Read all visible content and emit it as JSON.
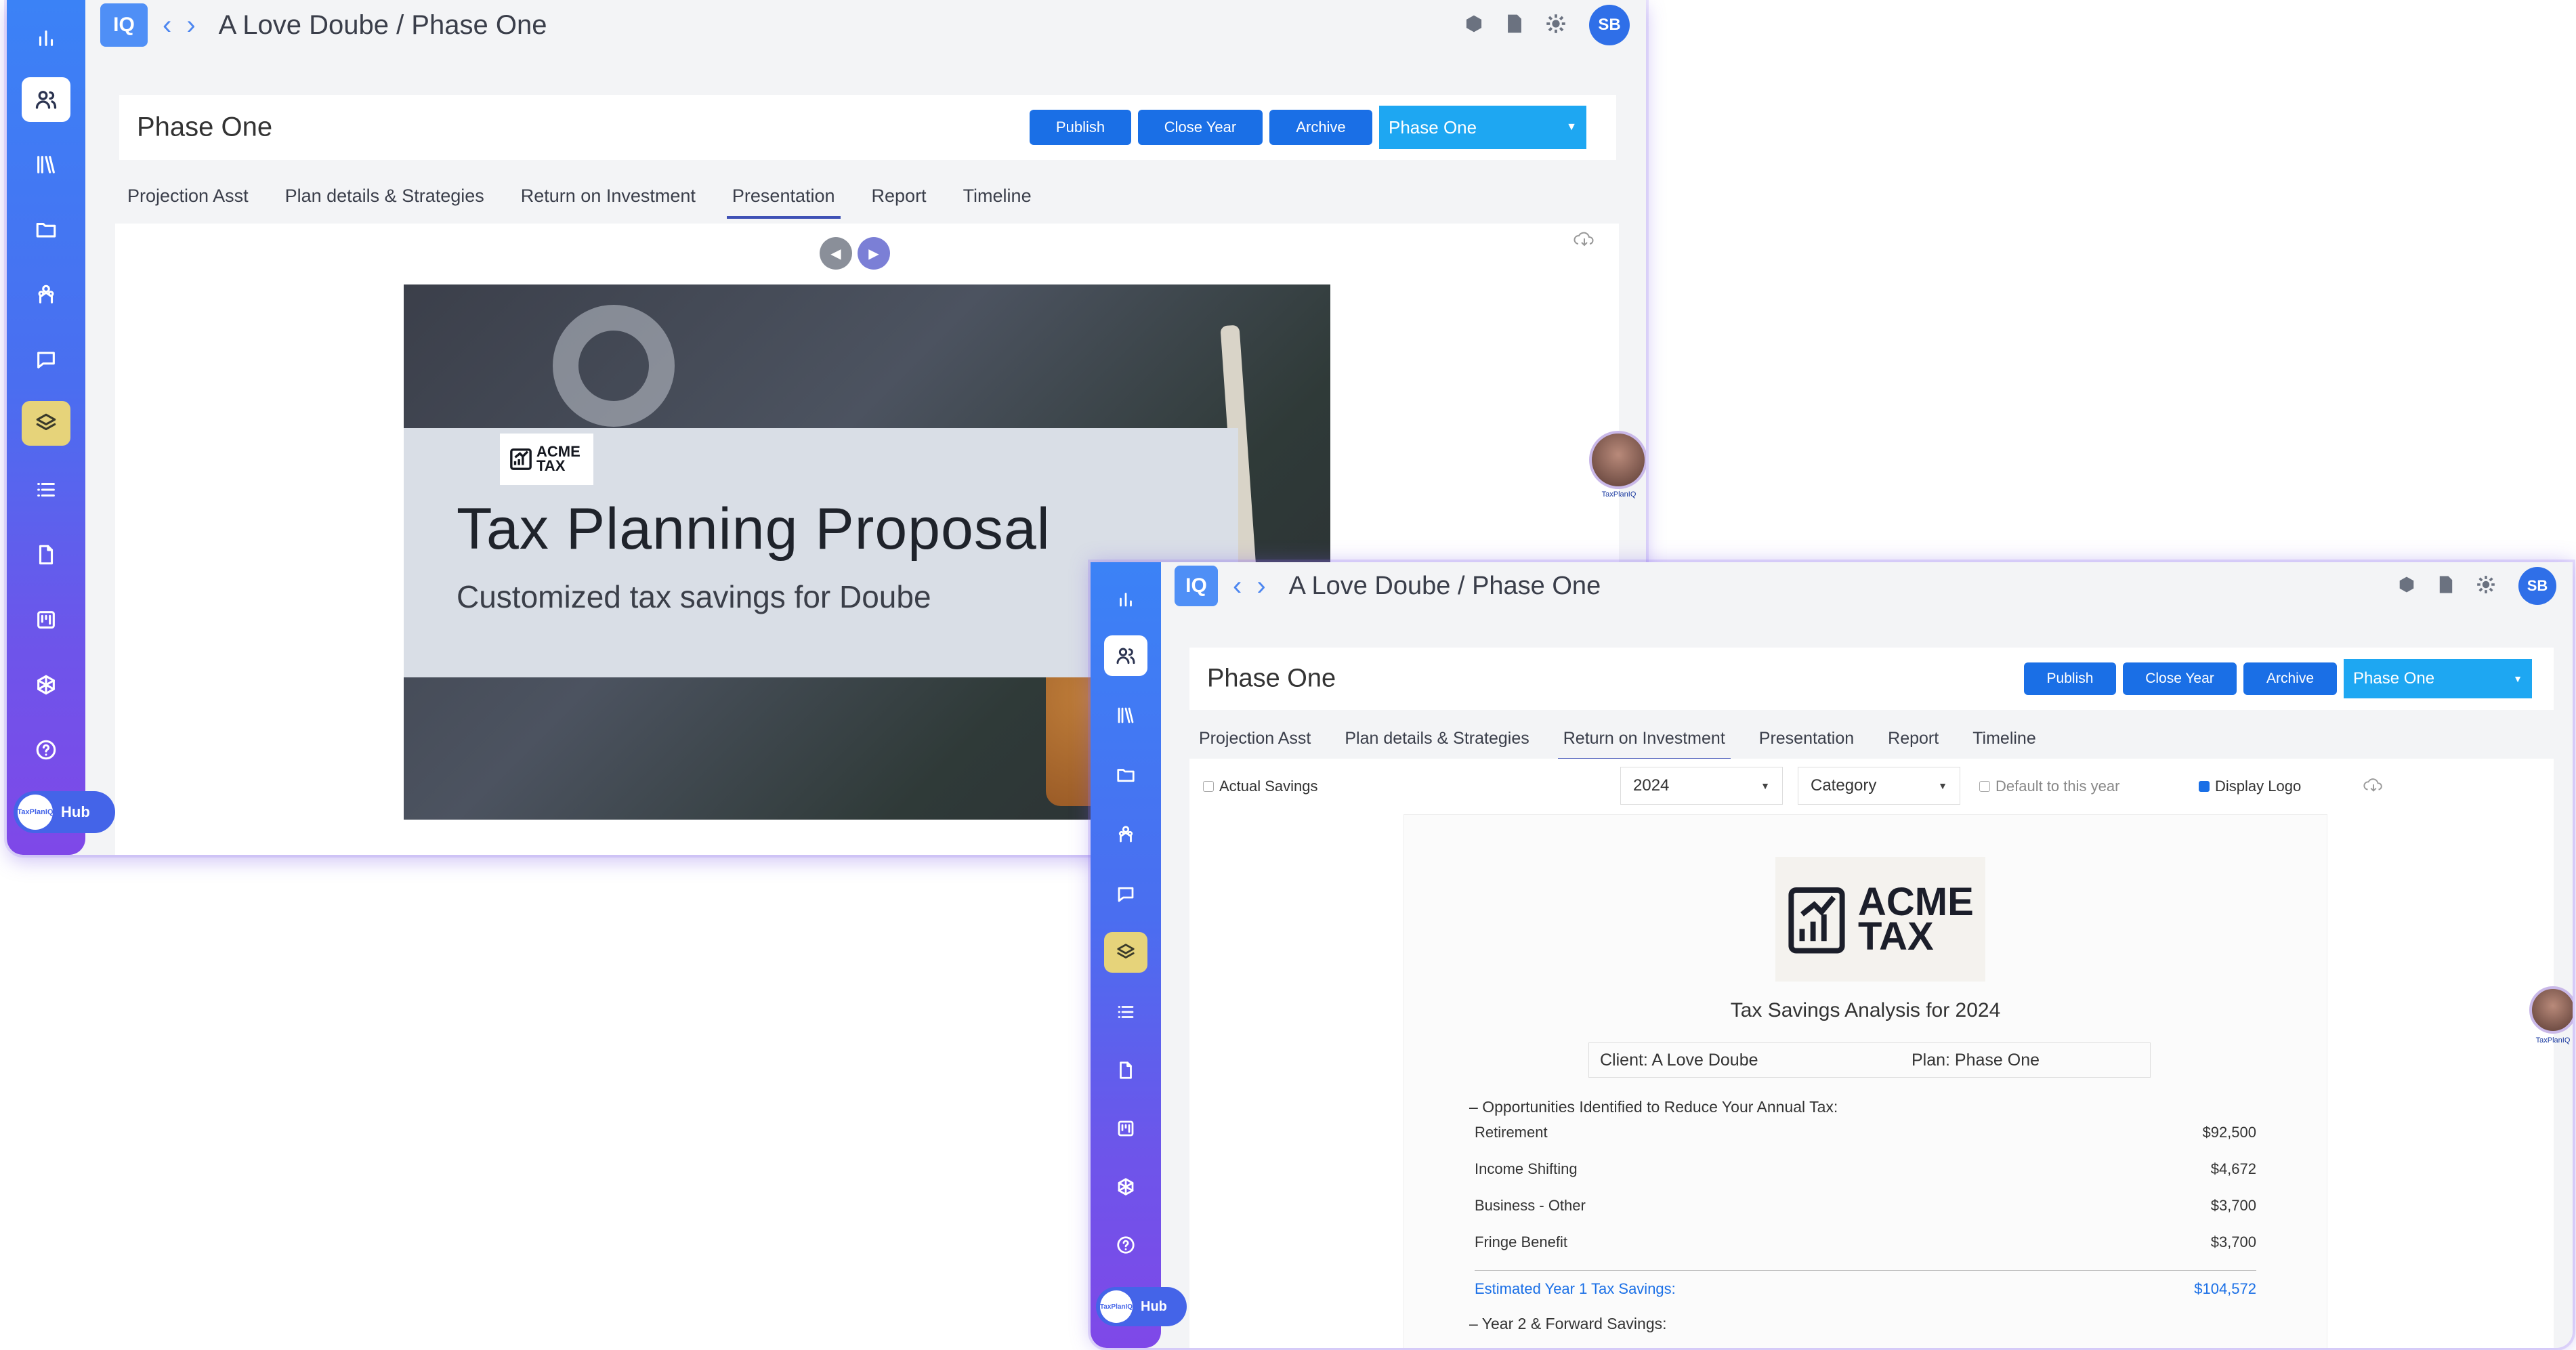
{
  "breadcrumb": "A Love Doube / Phase One",
  "app_icon_label": "IQ",
  "user_initials": "SB",
  "hub_label": "Hub",
  "hub_logo_text": "TaxPlanIQ",
  "phase_title": "Phase One",
  "buttons": {
    "publish": "Publish",
    "close_year": "Close Year",
    "archive": "Archive"
  },
  "phase_select": "Phase One",
  "tabs": [
    "Projection Asst",
    "Plan details & Strategies",
    "Return on Investment",
    "Presentation",
    "Report",
    "Timeline"
  ],
  "window1": {
    "active_tab": "Presentation",
    "slide": {
      "logo": "ACME TAX",
      "title": "Tax Planning Proposal",
      "subtitle": "Customized tax savings for Doube"
    }
  },
  "window2": {
    "active_tab": "Return on Investment",
    "filters": {
      "actual_savings": "Actual Savings",
      "year": "2024",
      "category": "Category",
      "default_year": "Default to this year",
      "display_logo": "Display Logo"
    },
    "report": {
      "logo": "ACME TAX",
      "title": "Tax Savings Analysis for 2024",
      "client": "Client: A Love Doube",
      "plan": "Plan: Phase One",
      "section1": "Opportunities Identified to Reduce Your Annual Tax:",
      "items": [
        {
          "label": "Retirement",
          "value": "$92,500"
        },
        {
          "label": "Income Shifting",
          "value": "$4,672"
        },
        {
          "label": "Business - Other",
          "value": "$3,700"
        },
        {
          "label": "Fringe Benefit",
          "value": "$3,700"
        }
      ],
      "total_label": "Estimated Year 1 Tax Savings:",
      "total_value": "$104,572",
      "section2": "Year 2 & Forward Savings:"
    }
  },
  "agent_caption": "TaxPlanIQ",
  "colors": {
    "primary_button": "#1a6fe6",
    "select": "#1ea7f2",
    "tab_underline": "#3f51b5",
    "highlight_nav": "#e6d37a"
  }
}
